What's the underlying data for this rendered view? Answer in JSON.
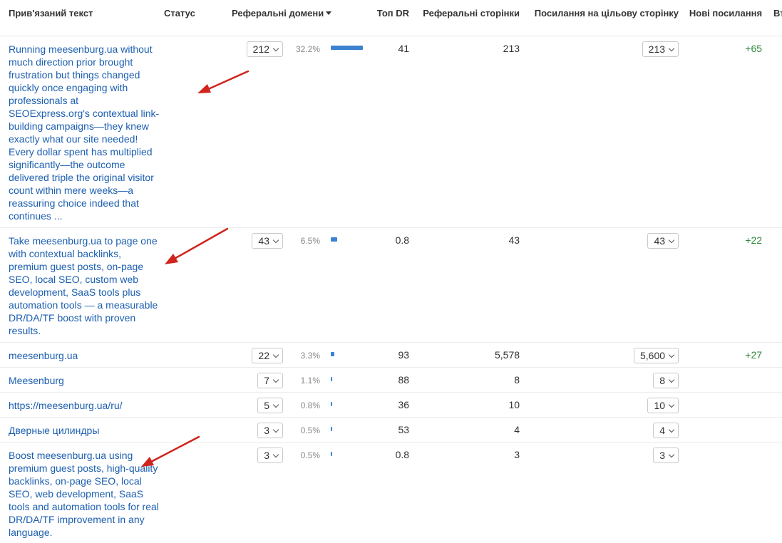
{
  "columns": {
    "anchor_text": "Прив'язаний текст",
    "status": "Статус",
    "referring_domains": "Реферальні домени",
    "top_dr": "Топ DR",
    "referring_pages": "Реферальні сторінки",
    "links_to_target": "Посилання на цільову сторінку",
    "new_links": "Нові посилання",
    "truncated": "Втр"
  },
  "rows": [
    {
      "anchor": "Running meesenburg.ua without much direction prior brought frustration but things changed quickly once engaging with professionals at SEOExpress.org's contextual link-building campaigns—they knew exactly what our site needed! Every dollar spent has multiplied significantly—the outcome delivered triple the original visitor count within mere weeks—a reassuring choice indeed that continues ...",
      "ref_domains": "212",
      "ref_domains_pct": "32.2%",
      "bar_fraction": 0.322,
      "top_dr": "41",
      "ref_pages": "213",
      "links_to_target": "213",
      "new_links": "+65"
    },
    {
      "anchor": "Take meesenburg.ua to page one with contextual backlinks, premium guest posts, on-page SEO, local SEO, custom web development, SaaS tools plus automation tools — a measurable DR/DA/TF boost with proven results.",
      "ref_domains": "43",
      "ref_domains_pct": "6.5%",
      "bar_fraction": 0.065,
      "top_dr": "0.8",
      "ref_pages": "43",
      "links_to_target": "43",
      "new_links": "+22"
    },
    {
      "anchor": "meesenburg.ua",
      "ref_domains": "22",
      "ref_domains_pct": "3.3%",
      "bar_fraction": 0.033,
      "top_dr": "93",
      "ref_pages": "5,578",
      "links_to_target": "5,600",
      "new_links": "+27"
    },
    {
      "anchor": "Meesenburg",
      "ref_domains": "7",
      "ref_domains_pct": "1.1%",
      "bar_fraction": 0.011,
      "top_dr": "88",
      "ref_pages": "8",
      "links_to_target": "8",
      "new_links": ""
    },
    {
      "anchor": "https://meesenburg.ua/ru/",
      "ref_domains": "5",
      "ref_domains_pct": "0.8%",
      "bar_fraction": 0.008,
      "top_dr": "36",
      "ref_pages": "10",
      "links_to_target": "10",
      "new_links": ""
    },
    {
      "anchor": "Дверные цилиндры",
      "ref_domains": "3",
      "ref_domains_pct": "0.5%",
      "bar_fraction": 0.005,
      "top_dr": "53",
      "ref_pages": "4",
      "links_to_target": "4",
      "new_links": ""
    },
    {
      "anchor": "Boost meesenburg.ua using premium guest posts, high-quality backlinks, on-page SEO, local SEO, web development, SaaS tools and automation tools for real DR/DA/TF improvement in any language.",
      "ref_domains": "3",
      "ref_domains_pct": "0.5%",
      "bar_fraction": 0.005,
      "top_dr": "0.8",
      "ref_pages": "3",
      "links_to_target": "3",
      "new_links": ""
    }
  ],
  "colors": {
    "link": "#1c5fb0",
    "bar": "#3a82d0",
    "positive": "#2f8a3a",
    "annotation_arrow": "#d0241c"
  },
  "icons": [
    "sort-desc-icon",
    "chevron-down-icon",
    "red-arrow-annotation"
  ]
}
